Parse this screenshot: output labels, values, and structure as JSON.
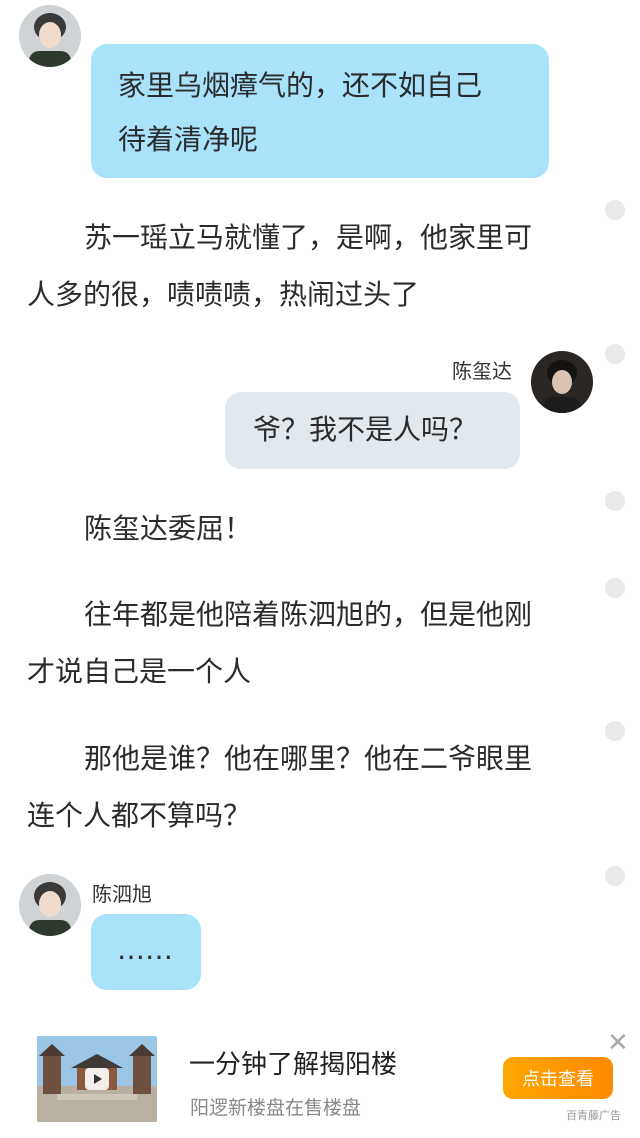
{
  "messages": [
    {
      "text_lines": [
        "家里乌烟瘴气的，还不如自己",
        "待着清净呢"
      ]
    },
    {
      "speaker": "陈玺达",
      "text": "爷？我不是人吗？"
    },
    {
      "speaker": "陈泗旭",
      "text": "……"
    }
  ],
  "paragraphs": [
    {
      "lines": [
        "苏一瑶立马就懂了，是啊，他家里可",
        "人多的很，啧啧啧，热闹过头了"
      ]
    },
    {
      "lines": [
        "陈玺达委屈！"
      ]
    },
    {
      "lines": [
        "往年都是他陪着陈泗旭的，但是他刚",
        "才说自己是一个人"
      ]
    },
    {
      "lines": [
        "那他是谁？他在哪里？他在二爷眼里",
        "连个人都不算吗？"
      ]
    }
  ],
  "ad": {
    "title": "一分钟了解揭阳楼",
    "subtitle": "阳逻新楼盘在售楼盘",
    "button_label": "点击查看",
    "source_tag": "百青藤广告",
    "close_icon": "✕"
  },
  "colors": {
    "bubble_blue": "#a8e2fb",
    "bubble_gray": "#e1e8ee",
    "button_orange": "#ff9800"
  }
}
